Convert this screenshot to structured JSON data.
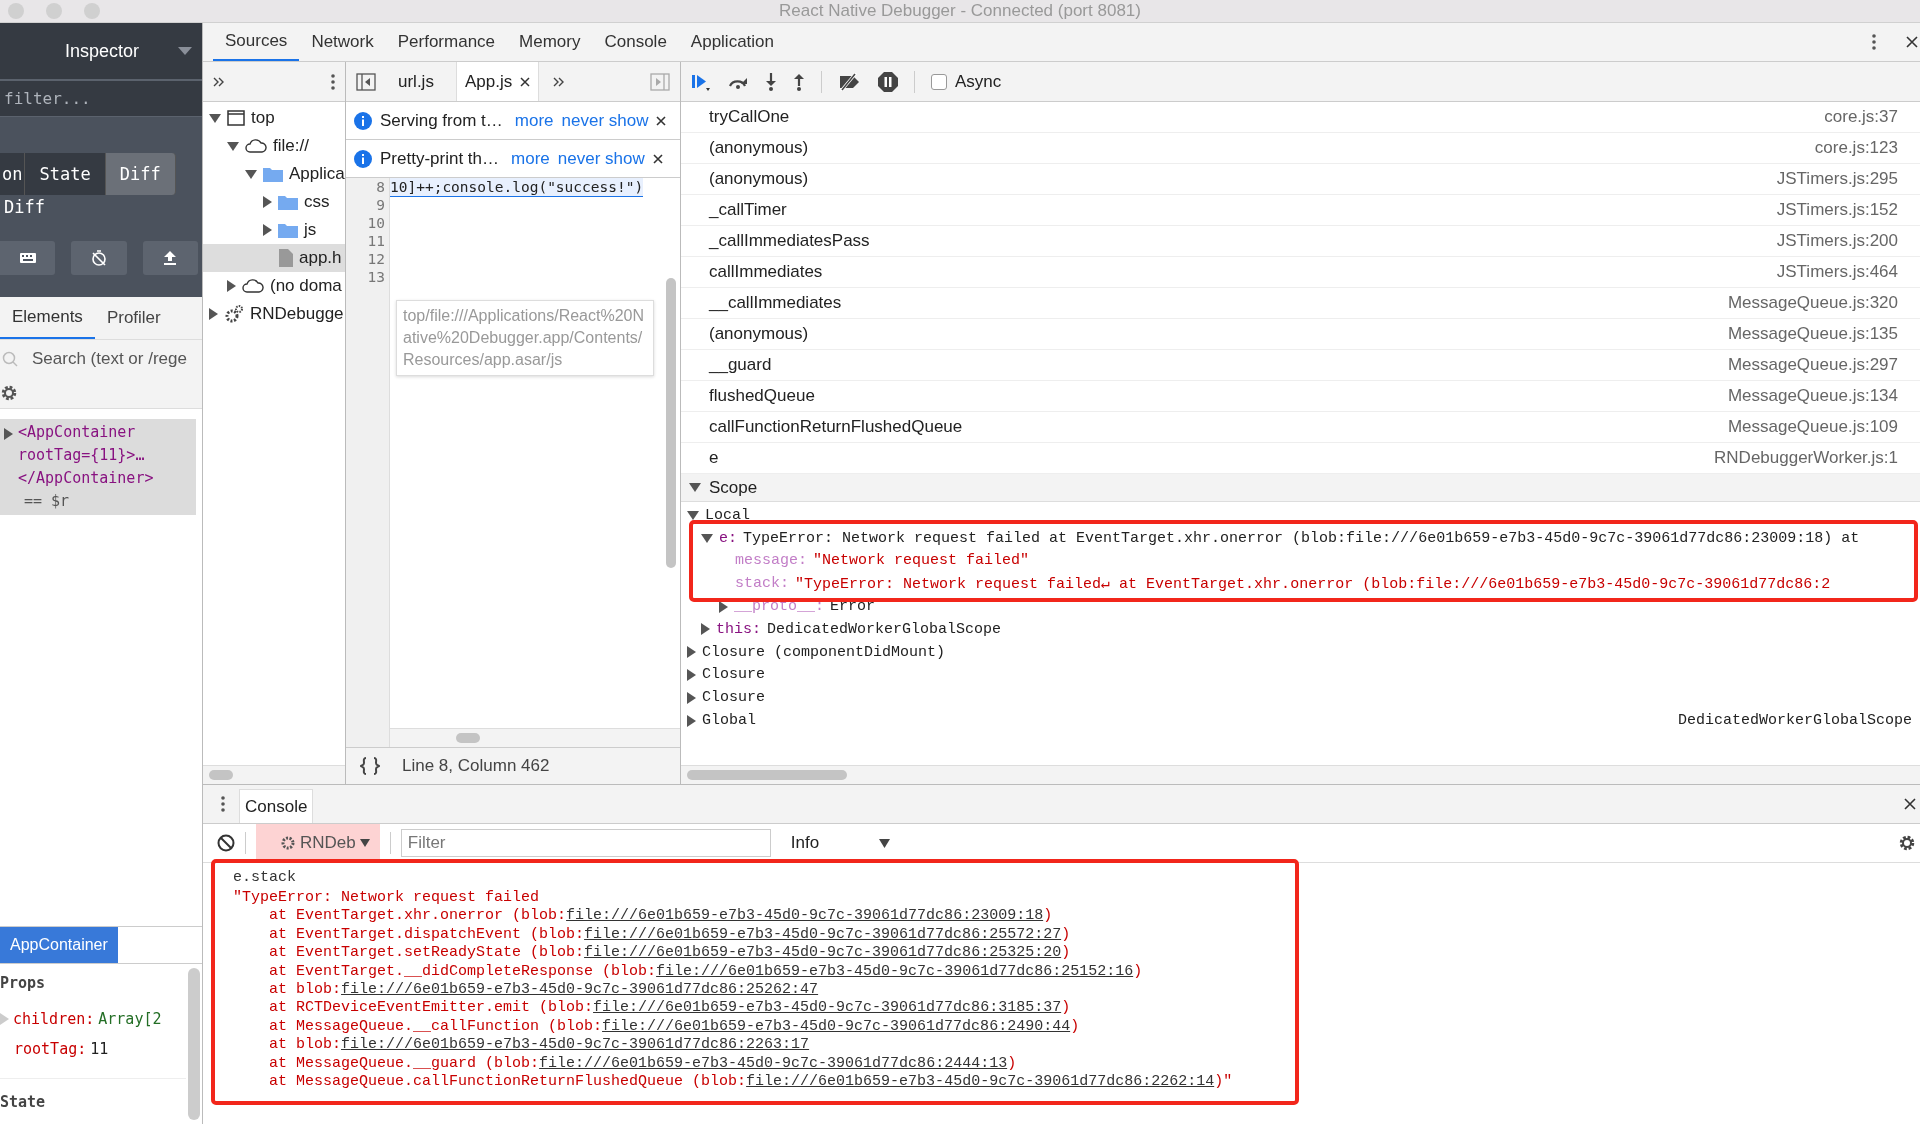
{
  "window": {
    "title": "React Native Debugger - Connected (port 8081)"
  },
  "inspector": {
    "title": "Inspector",
    "filter_placeholder": "filter...",
    "tabs": [
      {
        "label": "on",
        "selected": false
      },
      {
        "label": "State",
        "selected": false
      },
      {
        "label": "Diff",
        "selected": true
      }
    ],
    "section_label": "Diff"
  },
  "react_devtools": {
    "tabs": [
      {
        "label": "Elements",
        "selected": true
      },
      {
        "label": "Profiler",
        "selected": false
      }
    ],
    "search_placeholder": "Search (text or /rege",
    "tree": [
      {
        "text": "<AppContainer rootTag={11}>…</AppContainer>",
        "suffix": "== $r",
        "expanded": false,
        "selected": true
      }
    ],
    "breadcrumb": "AppContainer",
    "props_title": "Props",
    "props": [
      {
        "key": "children:",
        "value": "Array[2",
        "expandable": true
      },
      {
        "key": "rootTag:",
        "value": "11",
        "expandable": false
      }
    ],
    "state_title": "State"
  },
  "devtools": {
    "tabs": [
      {
        "label": "Sources",
        "selected": true
      },
      {
        "label": "Network",
        "selected": false
      },
      {
        "label": "Performance",
        "selected": false
      },
      {
        "label": "Memory",
        "selected": false
      },
      {
        "label": "Console",
        "selected": false
      },
      {
        "label": "Application",
        "selected": false
      }
    ],
    "navigator": [
      {
        "label": "top",
        "kind": "frame",
        "expanded": true,
        "selected": false,
        "children": [
          {
            "label": "file://",
            "kind": "cloud",
            "expanded": true,
            "selected": false,
            "children": [
              {
                "label": "Applica",
                "kind": "folder",
                "expanded": true,
                "selected": false,
                "children": [
                  {
                    "label": "css",
                    "kind": "folder",
                    "expanded": false,
                    "selected": false
                  },
                  {
                    "label": "js",
                    "kind": "folder",
                    "expanded": false,
                    "selected": false
                  },
                  {
                    "label": "app.h",
                    "kind": "file",
                    "selected": true
                  }
                ]
              }
            ]
          },
          {
            "label": "(no doma",
            "kind": "cloud",
            "expanded": false,
            "selected": false
          }
        ]
      },
      {
        "label": "RNDebugge",
        "kind": "gear",
        "expanded": false,
        "selected": false
      }
    ],
    "editor_tabs": [
      {
        "label": "url.js",
        "selected": false,
        "closable": false
      },
      {
        "label": "App.js",
        "selected": true,
        "closable": true
      }
    ],
    "infobars": [
      {
        "text": "Serving from t…",
        "links": [
          "more",
          "never show"
        ]
      },
      {
        "text": "Pretty-print th…",
        "links": [
          "more",
          "never show"
        ]
      }
    ],
    "lines": [
      {
        "number": "8",
        "code": "10]++;console.log(\"success!\")",
        "current": true
      },
      {
        "number": "9",
        "current": false
      },
      {
        "number": "10",
        "current": false
      },
      {
        "number": "11",
        "current": false
      },
      {
        "number": "12",
        "current": false
      },
      {
        "number": "13",
        "current": false
      }
    ],
    "cursor": "Line 8, Column 462",
    "tooltip": "top/file:///Applications/React%20Native%20Debugger.app/Contents/Resources/app.asar/js",
    "async": {
      "label": "Async",
      "checked": false
    },
    "call_stack": [
      {
        "name": "tryCallOne",
        "location": "core.js:37"
      },
      {
        "name": "(anonymous)",
        "location": "core.js:123"
      },
      {
        "name": "(anonymous)",
        "location": "JSTimers.js:295"
      },
      {
        "name": "_callTimer",
        "location": "JSTimers.js:152"
      },
      {
        "name": "_callImmediatesPass",
        "location": "JSTimers.js:200"
      },
      {
        "name": "callImmediates",
        "location": "JSTimers.js:464"
      },
      {
        "name": "__callImmediates",
        "location": "MessageQueue.js:320"
      },
      {
        "name": "(anonymous)",
        "location": "MessageQueue.js:135"
      },
      {
        "name": "__guard",
        "location": "MessageQueue.js:297"
      },
      {
        "name": "flushedQueue",
        "location": "MessageQueue.js:134"
      },
      {
        "name": "callFunctionReturnFlushedQueue",
        "location": "MessageQueue.js:109"
      },
      {
        "name": "e",
        "location": "RNDebuggerWorker.js:1"
      }
    ],
    "scope": {
      "title": "Scope",
      "expanded": true,
      "local": "Local",
      "items": [
        {
          "name": "e:",
          "value": "TypeError: Network request failed at EventTarget.xhr.onerror (blob:file:///6e01b659-e7b3-45d0-9c7c-39061d77dc86:23009:18) at",
          "expanded": true,
          "kind": "object",
          "children": [
            {
              "name": "message:",
              "value": "\"Network request failed\"",
              "kind": "string"
            },
            {
              "name": "stack:",
              "value": "\"TypeError: Network request failed↵    at EventTarget.xhr.onerror (blob:file:///6e01b659-e7b3-45d0-9c7c-39061d77dc86:2",
              "kind": "string"
            },
            {
              "name": "__proto__:",
              "value": "Error",
              "kind": "object",
              "expanded": false
            }
          ]
        },
        {
          "name": "this:",
          "value": "DedicatedWorkerGlobalScope",
          "kind": "object",
          "expanded": false
        }
      ],
      "sections": [
        {
          "label": "Closure (componentDidMount)"
        },
        {
          "label": "Closure"
        },
        {
          "label": "Closure"
        },
        {
          "label": "Global",
          "value": "DedicatedWorkerGlobalScope"
        }
      ]
    }
  },
  "console": {
    "tab": "Console",
    "context": "RNDeb",
    "filter_placeholder": "Filter",
    "level": "Info",
    "input": "e.stack",
    "output": [
      {
        "text": "\"TypeError: Network request failed"
      },
      {
        "text": "    at EventTarget.xhr.onerror (blob:",
        "link": "file:///6e01b659-e7b3-45d0-9c7c-39061d77dc86:23009:18",
        "tail": ")"
      },
      {
        "text": "    at EventTarget.dispatchEvent (blob:",
        "link": "file:///6e01b659-e7b3-45d0-9c7c-39061d77dc86:25572:27",
        "tail": ")"
      },
      {
        "text": "    at EventTarget.setReadyState (blob:",
        "link": "file:///6e01b659-e7b3-45d0-9c7c-39061d77dc86:25325:20",
        "tail": ")"
      },
      {
        "text": "    at EventTarget.__didCompleteResponse (blob:",
        "link": "file:///6e01b659-e7b3-45d0-9c7c-39061d77dc86:25152:16",
        "tail": ")"
      },
      {
        "text": "    at blob:",
        "link": "file:///6e01b659-e7b3-45d0-9c7c-39061d77dc86:25262:47"
      },
      {
        "text": "    at RCTDeviceEventEmitter.emit (blob:",
        "link": "file:///6e01b659-e7b3-45d0-9c7c-39061d77dc86:3185:37",
        "tail": ")"
      },
      {
        "text": "    at MessageQueue.__callFunction (blob:",
        "link": "file:///6e01b659-e7b3-45d0-9c7c-39061d77dc86:2490:44",
        "tail": ")"
      },
      {
        "text": "    at blob:",
        "link": "file:///6e01b659-e7b3-45d0-9c7c-39061d77dc86:2263:17"
      },
      {
        "text": "    at MessageQueue.__guard (blob:",
        "link": "file:///6e01b659-e7b3-45d0-9c7c-39061d77dc86:2444:13",
        "tail": ")"
      },
      {
        "text": "    at MessageQueue.callFunctionReturnFlushedQueue (blob:",
        "link": "file:///6e01b659-e7b3-45d0-9c7c-39061d77dc86:2262:14",
        "tail": ")\""
      }
    ]
  }
}
